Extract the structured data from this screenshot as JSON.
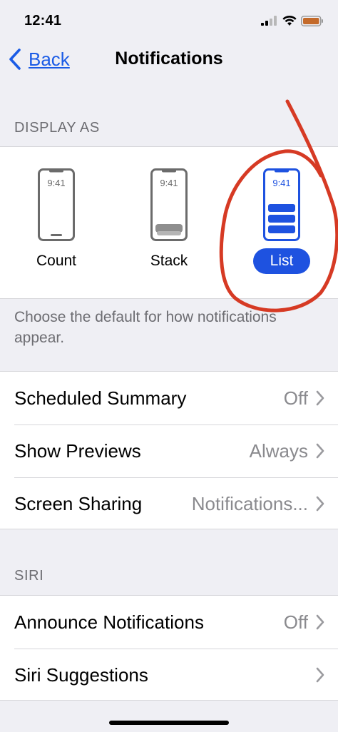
{
  "status_bar": {
    "time": "12:41"
  },
  "nav": {
    "back_label": "Back",
    "title": "Notifications"
  },
  "display_section": {
    "header": "DISPLAY AS",
    "options": [
      {
        "label": "Count",
        "phone_time": "9:41",
        "selected": false
      },
      {
        "label": "Stack",
        "phone_time": "9:41",
        "selected": false
      },
      {
        "label": "List",
        "phone_time": "9:41",
        "selected": true
      }
    ],
    "footer": "Choose the default for how notifications appear."
  },
  "settings_rows": [
    {
      "label": "Scheduled Summary",
      "value": "Off"
    },
    {
      "label": "Show Previews",
      "value": "Always"
    },
    {
      "label": "Screen Sharing",
      "value": "Notifications..."
    }
  ],
  "siri_section": {
    "header": "SIRI",
    "rows": [
      {
        "label": "Announce Notifications",
        "value": "Off"
      },
      {
        "label": "Siri Suggestions",
        "value": ""
      }
    ]
  },
  "colors": {
    "accent": "#1e52e0",
    "link": "#1a5be6",
    "background": "#efeff4",
    "secondary_text": "#8a8a8e",
    "annotation": "#d63a24",
    "battery": "#c46a2a"
  },
  "icons": {
    "back": "chevron-left-icon",
    "row_disclosure": "chevron-right-icon",
    "signal": "cellular-signal-icon",
    "wifi": "wifi-icon",
    "battery": "battery-icon"
  }
}
